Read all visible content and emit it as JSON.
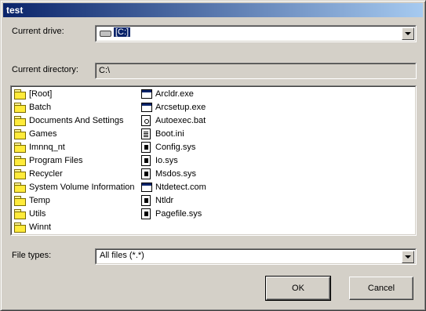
{
  "window": {
    "title": "test"
  },
  "drive": {
    "label": "Current drive:",
    "value": "[C:]"
  },
  "directory": {
    "label": "Current directory:",
    "value": "C:\\"
  },
  "folders": [
    {
      "name": "[Root]"
    },
    {
      "name": "Batch"
    },
    {
      "name": "Documents And Settings"
    },
    {
      "name": "Games"
    },
    {
      "name": "Imnnq_nt"
    },
    {
      "name": "Program Files"
    },
    {
      "name": "Recycler"
    },
    {
      "name": "System Volume Information"
    },
    {
      "name": "Temp"
    },
    {
      "name": "Utils"
    },
    {
      "name": "Winnt"
    }
  ],
  "files": [
    {
      "name": "Arcldr.exe",
      "icon": "exe-icon"
    },
    {
      "name": "Arcsetup.exe",
      "icon": "exe-icon"
    },
    {
      "name": "Autoexec.bat",
      "icon": "batch-icon"
    },
    {
      "name": "Boot.ini",
      "icon": "text-file-icon"
    },
    {
      "name": "Config.sys",
      "icon": "system-file-icon"
    },
    {
      "name": "Io.sys",
      "icon": "system-file-icon"
    },
    {
      "name": "Msdos.sys",
      "icon": "system-file-icon"
    },
    {
      "name": "Ntdetect.com",
      "icon": "exe-icon"
    },
    {
      "name": "Ntldr",
      "icon": "system-file-icon"
    },
    {
      "name": "Pagefile.sys",
      "icon": "system-file-icon"
    }
  ],
  "file_types": {
    "label": "File types:",
    "value": "All files (*.*)"
  },
  "buttons": {
    "ok": "OK",
    "cancel": "Cancel"
  },
  "colors": {
    "face": "#d4d0c8",
    "title_start": "#0a246a",
    "title_end": "#a6caf0",
    "selection": "#0a246a"
  }
}
